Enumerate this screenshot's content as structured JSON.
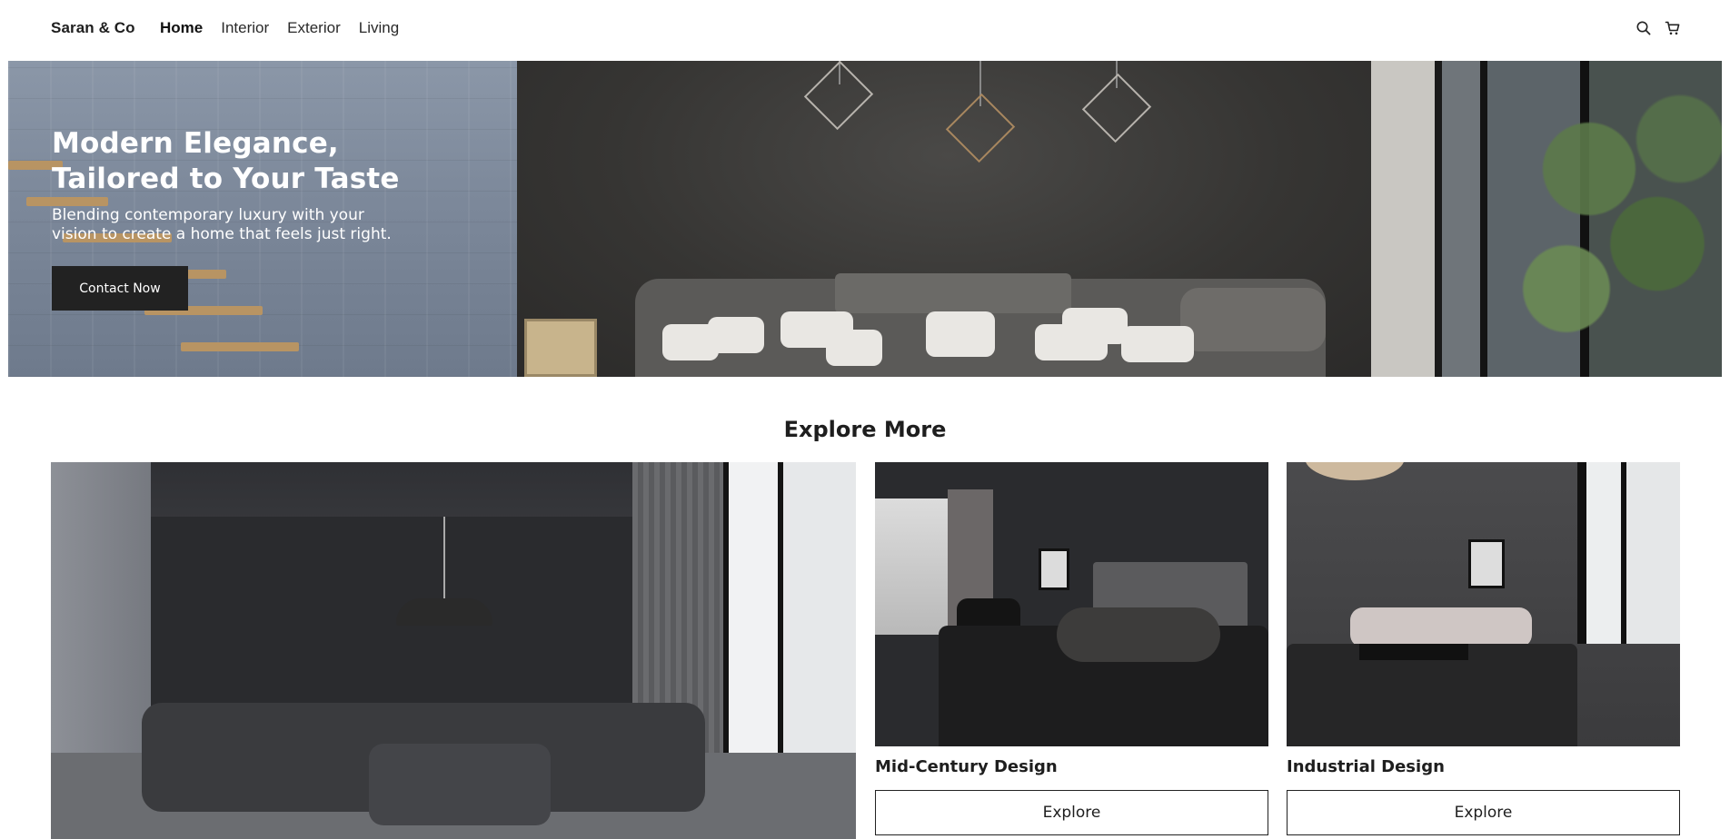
{
  "brand": {
    "name": "Saran & Co"
  },
  "nav": {
    "items": [
      {
        "label": "Home",
        "active": true
      },
      {
        "label": "Interior",
        "active": false
      },
      {
        "label": "Exterior",
        "active": false
      },
      {
        "label": "Living",
        "active": false
      }
    ],
    "icons": [
      "search-icon",
      "cart-icon"
    ]
  },
  "hero": {
    "title_line1": "Modern Elegance,",
    "title_line2": "Tailored to Your Taste",
    "subtitle_line1": "Blending contemporary luxury with your",
    "subtitle_line2": "vision to create a home that feels just right.",
    "cta_label": "Contact Now"
  },
  "explore": {
    "title": "Explore More",
    "cards": [
      {
        "name": "",
        "button": ""
      },
      {
        "name": "Mid-Century Design",
        "button": "Explore"
      },
      {
        "name": "Industrial Design",
        "button": "Explore"
      }
    ]
  },
  "colors": {
    "button_dark": "#222222",
    "text_dark": "#1e1e1e",
    "background": "#ffffff"
  }
}
